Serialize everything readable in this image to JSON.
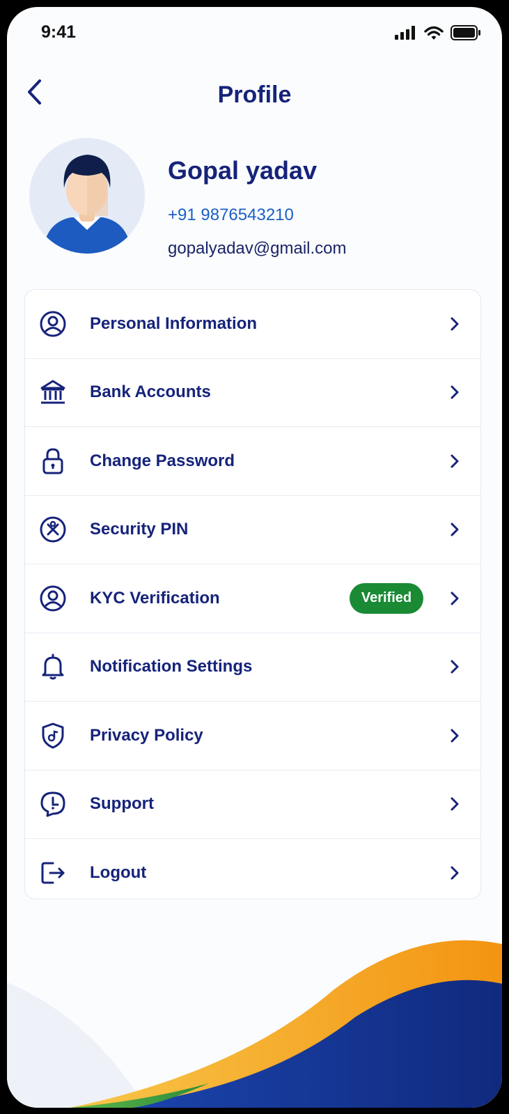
{
  "status_bar": {
    "time": "9:41",
    "icons": [
      "signal-icon",
      "wifi-icon",
      "battery-icon"
    ]
  },
  "header": {
    "back_icon": "chevron-left-icon",
    "title": "Profile"
  },
  "profile": {
    "name": "Gopal yadav",
    "phone": "+91 9876543210",
    "email": "gopalyadav@gmail.com"
  },
  "menu": {
    "items": [
      {
        "label": "Personal Information",
        "icon": "user-circle-icon"
      },
      {
        "label": "Bank Accounts",
        "icon": "bank-icon"
      },
      {
        "label": "Change Password",
        "icon": "lock-icon"
      },
      {
        "label": "Security PIN",
        "icon": "pin-icon"
      },
      {
        "label": "KYC Verification",
        "icon": "user-circle-icon",
        "badge": "Verified"
      },
      {
        "label": "Notification Settings",
        "icon": "bell-icon"
      },
      {
        "label": "Privacy Policy",
        "icon": "shield-icon"
      },
      {
        "label": "Support",
        "icon": "support-icon"
      },
      {
        "label": "Logout",
        "icon": "logout-icon"
      }
    ]
  },
  "colors": {
    "primary": "#16237a",
    "link": "#1b5fc4",
    "badge": "#1a8a35",
    "wave_orange": "#f5a21c",
    "wave_blue": "#14328f",
    "wave_green": "#2e9a3e"
  }
}
